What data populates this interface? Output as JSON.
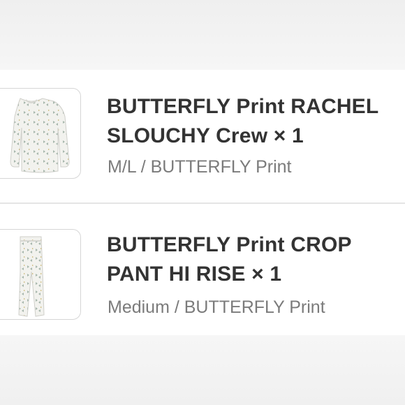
{
  "items": [
    {
      "title": "BUTTERFLY Print RACHEL SLOUCHY Crew × 1",
      "variant": "M/L / BUTTERFLY Print",
      "thumbnail_icon": "long-sleeve-top-icon"
    },
    {
      "title": "BUTTERFLY Print CROP PANT HI RISE × 1",
      "variant": "Medium / BUTTERFLY Print",
      "thumbnail_icon": "pants-icon"
    }
  ],
  "colors": {
    "title_text": "#333333",
    "variant_text": "#7b7b7b",
    "card_background": "#ffffff",
    "thumbnail_border": "#d6d6d6",
    "garment_fabric": "#f2f2ee",
    "print_accent": "#9fb0a8"
  }
}
